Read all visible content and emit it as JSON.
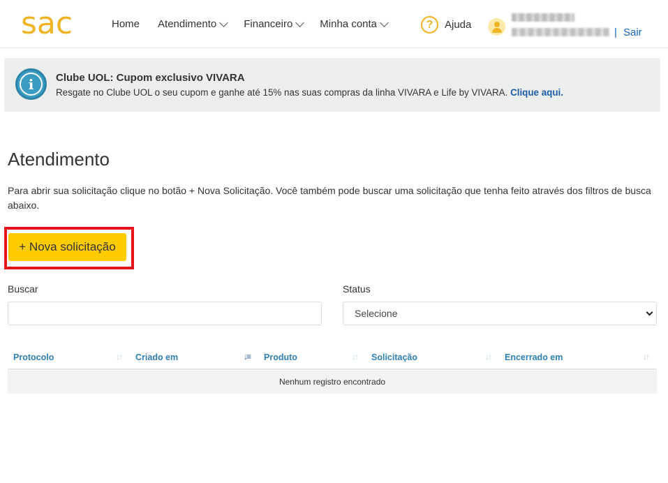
{
  "header": {
    "logo": "sac",
    "nav": [
      {
        "label": "Home"
      },
      {
        "label": "Atendimento"
      },
      {
        "label": "Financeiro"
      },
      {
        "label": "Minha conta"
      }
    ],
    "help_label": "Ajuda",
    "separator": "|",
    "logout_label": "Sair"
  },
  "banner": {
    "title": "Clube UOL: Cupom exclusivo VIVARA",
    "text": "Resgate no Clube UOL o seu cupom e ganhe até 15% nas suas compras da linha VIVARA e Life by VIVARA. ",
    "link": "Clique aqui."
  },
  "main": {
    "title": "Atendimento",
    "description": "Para abrir sua solicitação clique no botão + Nova Solicitação. Você também pode buscar uma solicitação que tenha feito através dos filtros de busca abaixo.",
    "new_button": "+ Nova solicitação",
    "search_label": "Buscar",
    "search_value": "",
    "status_label": "Status",
    "status_selected": "Selecione"
  },
  "table": {
    "columns": [
      "Protocolo",
      "Criado em",
      "Produto",
      "Solicitação",
      "Encerrado em"
    ],
    "empty_message": "Nenhum registro encontrado"
  },
  "colors": {
    "brand": "#f0b323",
    "button": "#ffcc00",
    "link": "#1565c0",
    "highlight": "#e8141c"
  }
}
